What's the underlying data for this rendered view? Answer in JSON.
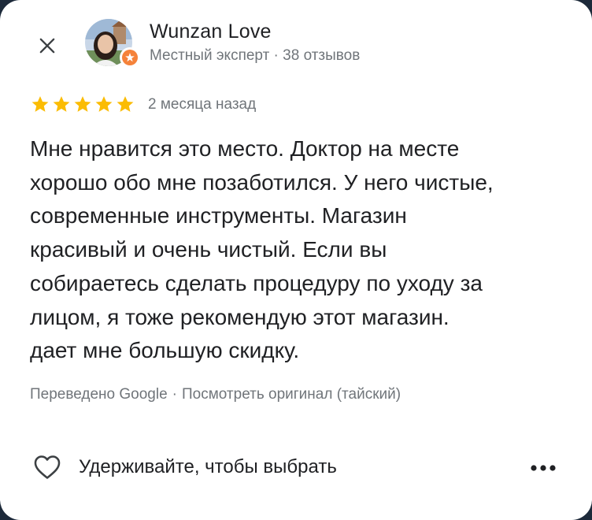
{
  "author": {
    "name": "Wunzan Love",
    "meta": "Местный эксперт · 38 отзывов"
  },
  "review": {
    "rating": 5,
    "max_rating": 5,
    "date": "2 месяца назад",
    "text": "Мне нравится это место. Доктор на месте\nхорошо обо мне позаботился. У него чистые,\nсовременные инструменты. Магазин\nкрасивый и очень чистый. Если вы\nсобираетесь сделать процедуру по уходу за\nлицом, я тоже рекомендую этот магазин.\nдает мне большую скидку."
  },
  "translation": {
    "note": "Переведено Google",
    "separator": "·",
    "view_original": "Посмотреть оригинал (тайский)"
  },
  "actions": {
    "like_label": "Удерживайте, чтобы выбрать"
  },
  "colors": {
    "star": "#fbbc04",
    "badge": "#f5823a",
    "secondary_text": "#70757a",
    "primary_text": "#202124"
  },
  "icons": {
    "close": "close-icon",
    "badge": "local-guide-badge-icon",
    "star": "star-icon",
    "like": "heart-icon",
    "more": "more-horizontal-icon"
  }
}
